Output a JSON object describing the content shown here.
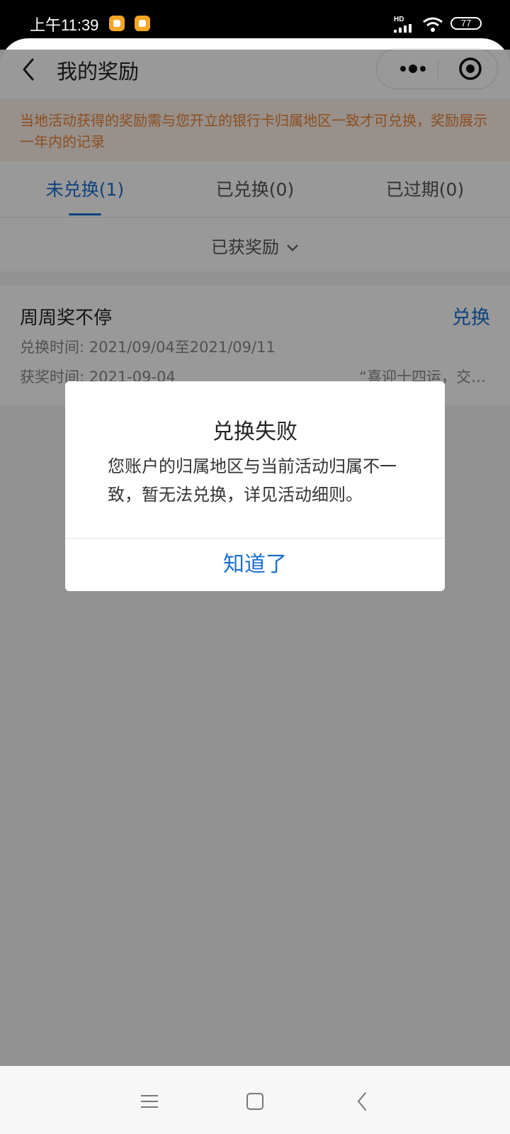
{
  "status_bar": {
    "time": "上午11:39",
    "network_label": "HD",
    "battery": "77"
  },
  "header": {
    "title": "我的奖励",
    "back_icon": "chevron-left-icon",
    "more_icon": "more-dots-icon",
    "close_icon": "target-circle-icon"
  },
  "notice": {
    "text": "当地活动获得的奖励需与您开立的银行卡归属地区一致才可兑换，奖励展示一年内的记录"
  },
  "tabs": [
    {
      "label": "未兑换(1)",
      "active": true
    },
    {
      "label": "已兑换(0)",
      "active": false
    },
    {
      "label": "已过期(0)",
      "active": false
    }
  ],
  "filter": {
    "label": "已获奖励",
    "icon": "chevron-down-icon"
  },
  "reward": {
    "title": "周周奖不停",
    "action": "兑换",
    "exchange_time": "兑换时间: 2021/09/04至2021/09/11",
    "award_time": "获奖时间: 2021-09-04",
    "description": "“喜迎十四运，交…"
  },
  "dialog": {
    "title": "兑换失败",
    "body": "您账户的归属地区与当前活动归属不一致，暂无法兑换，详见活动细则。",
    "button": "知道了"
  },
  "system_nav": {
    "icons": [
      "menu-icon",
      "home-square-icon",
      "back-chevron-icon"
    ]
  },
  "colors": {
    "accent": "#1a6fd1",
    "notice_text": "#e8843a",
    "notice_bg": "#fdf0e6",
    "overlay": "rgba(0,0,0,0.4)"
  }
}
